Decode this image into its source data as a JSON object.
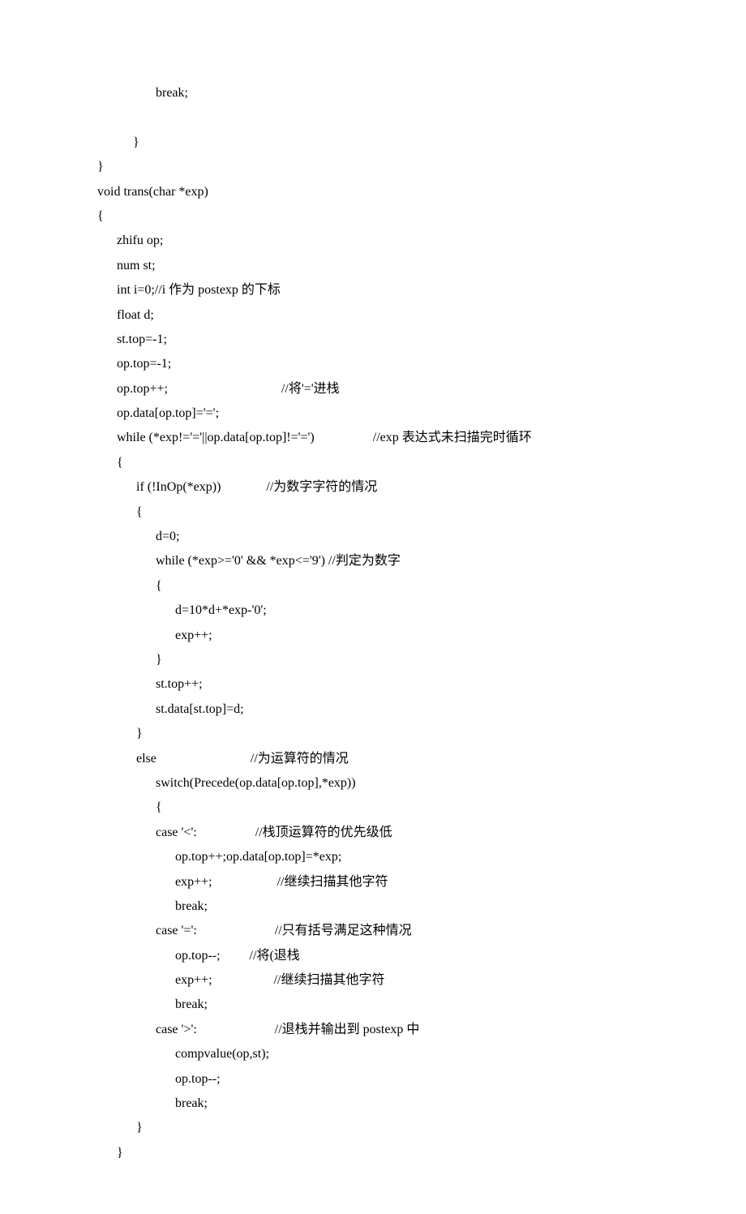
{
  "code_lines": [
    "                  break;",
    "",
    "           }",
    "}",
    "void trans(char *exp)",
    "{",
    "      zhifu op;",
    "      num st;",
    "      int i=0;//i 作为 postexp 的下标",
    "      float d;",
    "      st.top=-1;",
    "      op.top=-1;",
    "      op.top++;                                   //将'='进栈",
    "      op.data[op.top]='=';",
    "      while (*exp!='='||op.data[op.top]!='=')                  //exp 表达式未扫描完时循环",
    "      {",
    "            if (!InOp(*exp))              //为数字字符的情况",
    "            {",
    "                  d=0;",
    "                  while (*exp>='0' && *exp<='9') //判定为数字",
    "                  {",
    "                        d=10*d+*exp-'0';",
    "                        exp++;",
    "                  }",
    "                  st.top++;",
    "                  st.data[st.top]=d;",
    "            }",
    "            else                             //为运算符的情况",
    "                  switch(Precede(op.data[op.top],*exp))",
    "                  {",
    "                  case '<':                  //栈顶运算符的优先级低",
    "                        op.top++;op.data[op.top]=*exp;",
    "                        exp++;                    //继续扫描其他字符",
    "                        break;",
    "                  case '=':                        //只有括号满足这种情况",
    "                        op.top--;         //将(退栈",
    "                        exp++;                   //继续扫描其他字符",
    "                        break;",
    "                  case '>':                        //退栈并输出到 postexp 中",
    "                        compvalue(op,st);",
    "                        op.top--;",
    "                        break;",
    "            }",
    "      }"
  ]
}
